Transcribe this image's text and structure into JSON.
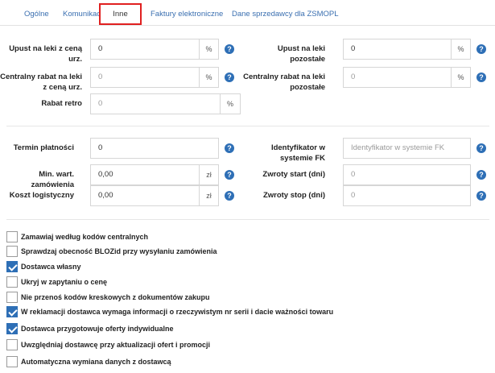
{
  "tabs": [
    "Ogólne",
    "Komunikacja",
    "Inne",
    "Faktury elektroniczne",
    "Dane sprzedawcy dla ZSMOPL"
  ],
  "help_glyph": "?",
  "section1": {
    "upust_ceny": {
      "label_1": "Upust na leki z ceną",
      "label_2": "urz.",
      "value": "0",
      "unit": "%"
    },
    "upust_pozostale": {
      "label_1": "Upust na leki",
      "label_2": "pozostałe",
      "value": "0",
      "unit": "%"
    },
    "rabat_central_ceny": {
      "label_1": "Centralny rabat na leki",
      "label_2": "z ceną urz.",
      "value": "0",
      "unit": "%"
    },
    "rabat_central_pozostale": {
      "label_1": "Centralny rabat na leki",
      "label_2": "pozostałe",
      "value": "0",
      "unit": "%"
    },
    "rabat_retro": {
      "label": "Rabat retro",
      "value": "0",
      "unit": "%"
    }
  },
  "section2": {
    "termin": {
      "label": "Termin płatności",
      "value": "0"
    },
    "identyfikator": {
      "label_1": "Identyfikator w",
      "label_2": "systemie FK",
      "placeholder": "Identyfikator w systemie FK"
    },
    "min_wart": {
      "label": "Min. wart. zamówienia",
      "value": "0,00",
      "unit": "zł"
    },
    "zwroty_start": {
      "label": "Zwroty start (dni)",
      "value": "0"
    },
    "koszt": {
      "label": "Koszt logistyczny",
      "value": "0,00",
      "unit": "zł"
    },
    "zwroty_stop": {
      "label": "Zwroty stop (dni)",
      "value": "0"
    }
  },
  "checkboxes": [
    {
      "label": "Zamawiaj według kodów centralnych",
      "checked": false
    },
    {
      "label": "Sprawdzaj obecność BLOZid przy wysyłaniu zamówienia",
      "checked": false
    },
    {
      "label": "Dostawca własny",
      "checked": true
    },
    {
      "label": "Ukryj w zapytaniu o cenę",
      "checked": false
    },
    {
      "label": "Nie przenoś kodów kreskowych z dokumentów zakupu",
      "checked": false
    },
    {
      "label": "W reklamacji dostawca wymaga informacji o rzeczywistym nr serii i dacie ważności towaru",
      "checked": true
    },
    {
      "label": "Dostawca przygotowuje oferty indywidualne",
      "checked": true
    },
    {
      "label": "Uwzględniaj dostawcę przy aktualizacji ofert i promocji",
      "checked": false
    },
    {
      "label": "Automatyczna wymiana danych z dostawcą",
      "checked": false
    }
  ],
  "colors": {
    "accent": "#2e6fb6",
    "active_tab_border": "#e02020",
    "link": "#3a6fb0"
  }
}
